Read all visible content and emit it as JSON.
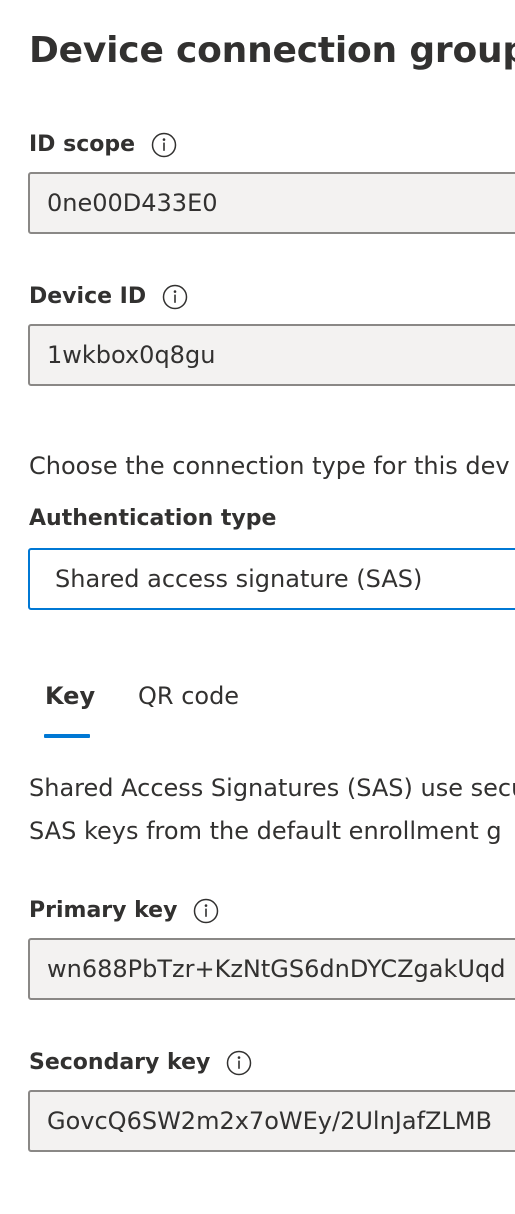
{
  "page": {
    "title": "Device connection groups"
  },
  "id_scope": {
    "label": "ID scope",
    "value": "0ne00D433E0",
    "info_icon": "info-icon"
  },
  "device_id": {
    "label": "Device ID",
    "value": "1wkbox0q8gu",
    "info_icon": "info-icon"
  },
  "connection": {
    "description": "Choose the connection type for this dev"
  },
  "authentication": {
    "label": "Authentication type",
    "selected": "Shared access signature (SAS)"
  },
  "tabs": [
    {
      "label": "Key",
      "selected": true
    },
    {
      "label": "QR code",
      "selected": false
    }
  ],
  "sas_description": {
    "line1": "Shared Access Signatures (SAS) use secu",
    "line2": "SAS keys from the default enrollment g"
  },
  "primary_key": {
    "label": "Primary key",
    "value": "wn688PbTzr+KzNtGS6dnDYCZgakUqd",
    "info_icon": "info-icon"
  },
  "secondary_key": {
    "label": "Secondary key",
    "value": "GovcQ6SW2m2x7oWEy/2UlnJafZLMB",
    "info_icon": "info-icon"
  },
  "colors": {
    "accent": "#0078d4",
    "text": "#323130",
    "field_background": "#f3f2f1",
    "field_border": "#8a8886"
  }
}
